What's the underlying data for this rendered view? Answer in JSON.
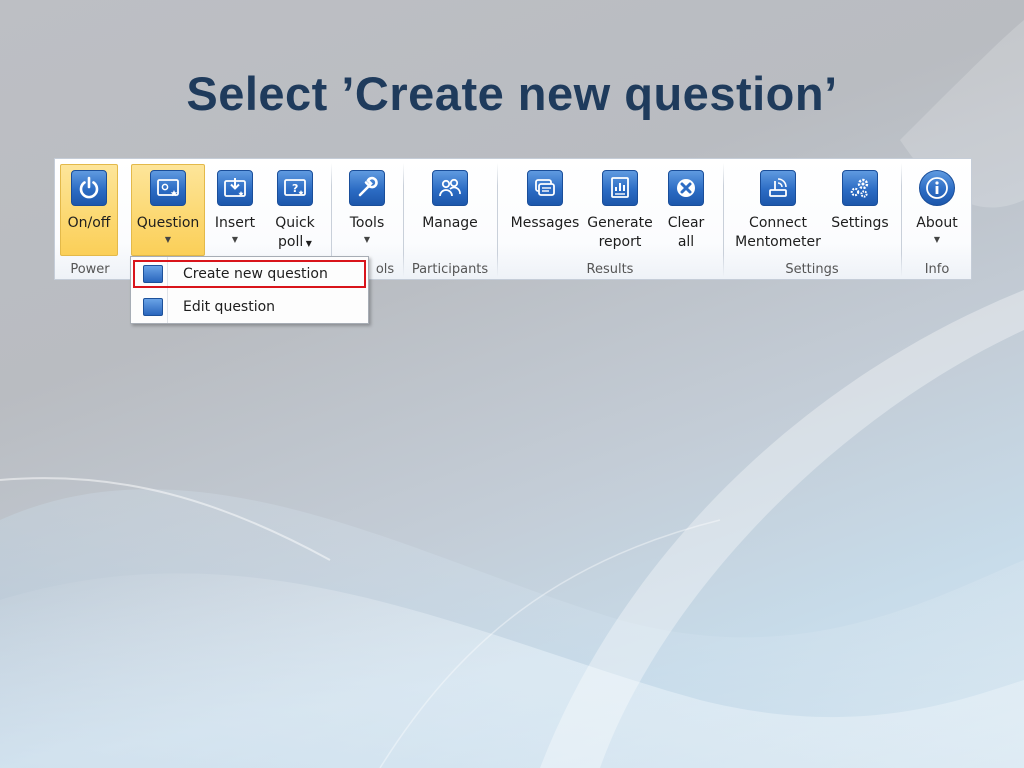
{
  "slide": {
    "title": "Select ’Create new question’"
  },
  "ribbon": {
    "buttons": [
      {
        "label": "On/off",
        "icon": "power-icon"
      },
      {
        "label": "Question",
        "icon": "question-slide-icon",
        "dropdown": true
      },
      {
        "label": "Insert",
        "icon": "insert-icon",
        "dropdown": true
      },
      {
        "label": "Quick",
        "label2": "poll",
        "icon": "quick-poll-icon",
        "dropdown": true
      },
      {
        "label": "Tools",
        "icon": "wrench-icon",
        "dropdown": true
      },
      {
        "label": "Manage",
        "icon": "participants-icon"
      },
      {
        "label": "Messages",
        "icon": "messages-icon"
      },
      {
        "label": "Generate",
        "label2": "report",
        "icon": "report-icon"
      },
      {
        "label": "Clear",
        "label2": "all",
        "icon": "clear-icon"
      },
      {
        "label": "Connect",
        "label2": "Mentometer",
        "icon": "connect-icon"
      },
      {
        "label": "Settings",
        "icon": "gears-icon"
      },
      {
        "label": "About",
        "icon": "info-icon",
        "dropdown": true
      }
    ],
    "groups": [
      "Power",
      "ols",
      "Participants",
      "Results",
      "Settings",
      "Info"
    ]
  },
  "menu": {
    "items": [
      {
        "label": "Create new question",
        "highlighted": true
      },
      {
        "label": "Edit question"
      }
    ]
  },
  "colors": {
    "title": "#1f3b5c",
    "active_button": "#fcd974",
    "highlight_border": "#d9141b",
    "icon_blue": "#2c6cc4"
  }
}
